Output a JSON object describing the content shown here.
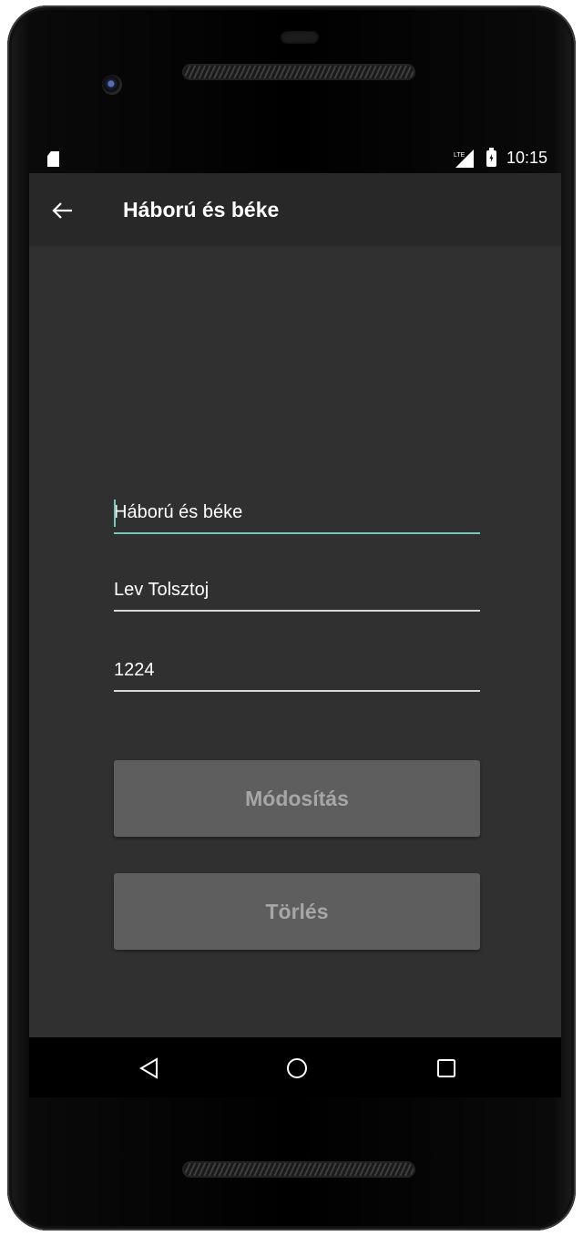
{
  "status_bar": {
    "time": "10:15",
    "left_icon": "sd-card-icon",
    "right_icons": [
      "signal-icon",
      "battery-charging-icon"
    ]
  },
  "app_bar": {
    "title": "Háború és béke",
    "nav_icon": "back-arrow-icon"
  },
  "form": {
    "title_value": "Háború és béke",
    "author_value": "Lev Tolsztoj",
    "year_value": "1224",
    "focused_field": "title",
    "accent_color": "#79c6b8"
  },
  "buttons": {
    "modify_label": "Módosítás",
    "delete_label": "Törlés"
  },
  "nav_bar": {
    "icons": [
      "nav-back-icon",
      "nav-home-icon",
      "nav-recents-icon"
    ]
  },
  "colors": {
    "app_bar": "#282828",
    "background": "#303030",
    "button": "#5e5e5e",
    "button_text": "#a6a6a6"
  }
}
